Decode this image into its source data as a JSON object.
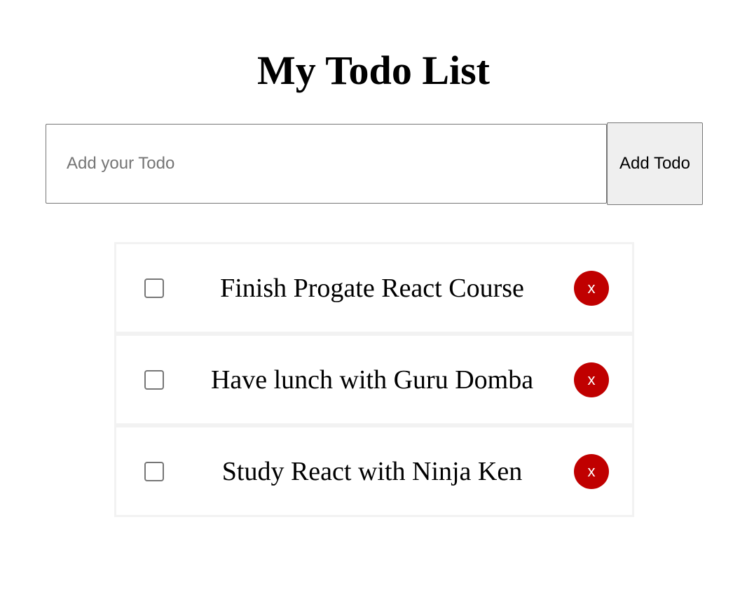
{
  "header": {
    "title": "My Todo List"
  },
  "form": {
    "input_value": "",
    "input_placeholder": "Add your Todo",
    "add_button_label": "Add Todo"
  },
  "todos": [
    {
      "text": "Finish Progate React Course",
      "done": false,
      "delete_label": "x"
    },
    {
      "text": "Have lunch with Guru Domba",
      "done": false,
      "delete_label": "x"
    },
    {
      "text": "Study React with Ninja Ken",
      "done": false,
      "delete_label": "x"
    }
  ],
  "colors": {
    "delete_button": "#c00000",
    "item_border": "#f2f2f2",
    "button_bg": "#efefef"
  }
}
